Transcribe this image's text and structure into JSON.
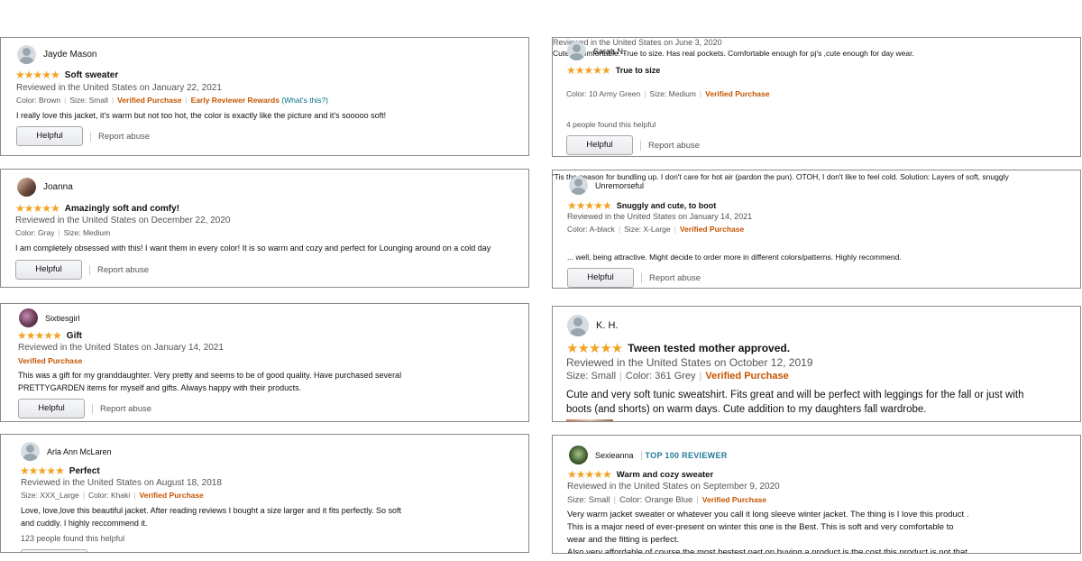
{
  "reviews": [
    {
      "name": "Jayde Mason",
      "stars": "★★★★★",
      "title": "Soft sweater",
      "meta": "Reviewed in the United States on January 22, 2021",
      "color": "Color: Brown",
      "size": "Size: Small",
      "verified": "Verified Purchase",
      "early": "Early Reviewer Rewards",
      "whats": "(What's this?)",
      "body": "I really love this jacket, it's warm but not too hot, the color is exactly like the picture and it's sooooo soft!",
      "helpful_label": "Helpful",
      "report_label": "Report abuse"
    },
    {
      "name": "Joanna",
      "stars": "★★★★★",
      "title": "Amazingly soft and comfy!",
      "meta": "Reviewed in the United States on December 22, 2020",
      "color": "Color: Gray",
      "size": "Size: Medium",
      "body": "I am completely obsessed with this! I want them in every color! It is so warm and cozy and perfect for Lounging around on a cold day",
      "helpful_label": "Helpful",
      "report_label": "Report abuse"
    },
    {
      "name": "Sixtiesgirl",
      "stars": "★★★★★",
      "title": "Gift",
      "meta": "Reviewed in the United States on January 14, 2021",
      "verified": "Verified Purchase",
      "body1": "This was a gift for my granddaughter. Very pretty and seems to be of good quality. Have purchased several",
      "body2": "PRETTYGARDEN items for myself and gifts. Always happy with their products.",
      "helpful_label": "Helpful",
      "report_label": "Report abuse"
    },
    {
      "name": "Arla Ann McLaren",
      "stars": "★★★★★",
      "title": "Perfect",
      "meta": "Reviewed in the United States on August 18, 2018",
      "size": "Size: XXX_Large",
      "color": "Color: Khaki",
      "verified": "Verified Purchase",
      "body1": "Love, love,love this beautiful jacket. After reading reviews I bought a size larger and it fits perfectly. So soft",
      "body2": "and cuddly. I highly reccommend it.",
      "helpful_count": "123 people found this helpful"
    },
    {
      "name": "Sarah N.",
      "stars": "★★★★★",
      "title": "True to size",
      "meta": "Reviewed in the United States on June 3, 2020",
      "color": "Color: 10 Army Green",
      "size": "Size: Medium",
      "verified": "Verified Purchase",
      "body": "Cute & comfortable. True to size. Has real pockets. Comfortable enough for pj's ,cute enough for day wear.",
      "helpful_count": "4 people found this helpful",
      "helpful_label": "Helpful",
      "report_label": "Report abuse"
    },
    {
      "name": "Unremorseful",
      "stars": "★★★★★",
      "title": "Snuggly and cute, to boot",
      "meta": "Reviewed in the United States on January 14, 2021",
      "color": "Color: A-black",
      "size": "Size: X-Large",
      "verified": "Verified Purchase",
      "body1": "'Tis the season for bundling up. I don't care for hot air (pardon the pun). OTOH, I don't like to feel cold. Solution: Layers of soft, snuggly",
      "body2": "... well, being attractive. Might decide to order more in different colors/patterns. Highly recommend.",
      "helpful_label": "Helpful",
      "report_label": "Report abuse"
    },
    {
      "name": "K. H.",
      "stars": "★★★★★",
      "title": "Tween tested mother approved.",
      "meta": "Reviewed in the United States on October 12, 2019",
      "size": "Size: Small",
      "color": "Color: 361 Grey",
      "verified": "Verified Purchase",
      "body1": "Cute and very soft tunic sweatshirt. Fits great and will be perfect with leggings for the fall or just with",
      "body2": "boots (and shorts) on warm days. Cute addition to my daughters fall wardrobe."
    },
    {
      "name": "Sexieanna",
      "badge": "TOP 100 REVIEWER",
      "stars": "★★★★★",
      "title": "Warm and cozy sweater",
      "meta": "Reviewed in the United States on September 9, 2020",
      "size": "Size: Small",
      "color": "Color: Orange Blue",
      "verified": "Verified Purchase",
      "body1": "Very warm jacket sweater or whatever you call it long sleeve winter jacket. The thing is I love this product .",
      "body2": "This is a major need of ever-present on winter this one is the Best. This is soft and very comfortable to",
      "body3": "wear and the fitting is perfect.",
      "body4": "Also very affordable of course the most bestest part on buying a product is the cost this product is not that"
    }
  ]
}
